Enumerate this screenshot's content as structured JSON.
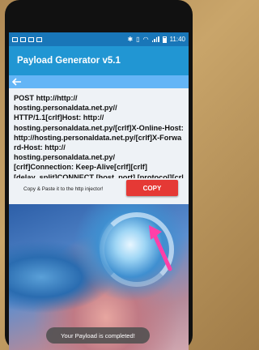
{
  "statusbar": {
    "time": "11:40"
  },
  "app": {
    "title": "Payload Generator v5.1"
  },
  "payload": {
    "text": "POST http://http://\nhosting.personaldata.net.py//\nHTTP/1.1[crlf]Host: http://\nhosting.personaldata.net.py/[crlf]X-Online-Host: http://hosting.personaldata.net.py/[crlf]X-Forward-Host: http://\nhosting.personaldata.net.py/\n[crlf]Connection: Keep-Alive[crlf][crlf]\n[delay_split]CONNECT [host_port] [protocol][crlf][crlf]"
  },
  "copy": {
    "hint": "Copy & Paste it to the http injector!",
    "button_label": "COPY"
  },
  "toast": {
    "message": "Your Payload is completed!"
  },
  "colors": {
    "statusbar": "#1976b8",
    "appbar": "#2196d3",
    "backbar": "#64b5f6",
    "copy_button": "#e53935",
    "annotation_arrow": "#ff3fa8"
  },
  "icons": [
    "back-arrow-icon",
    "notification-icon",
    "bluetooth-icon",
    "vibrate-icon",
    "wifi-icon",
    "signal-icon",
    "battery-icon"
  ]
}
